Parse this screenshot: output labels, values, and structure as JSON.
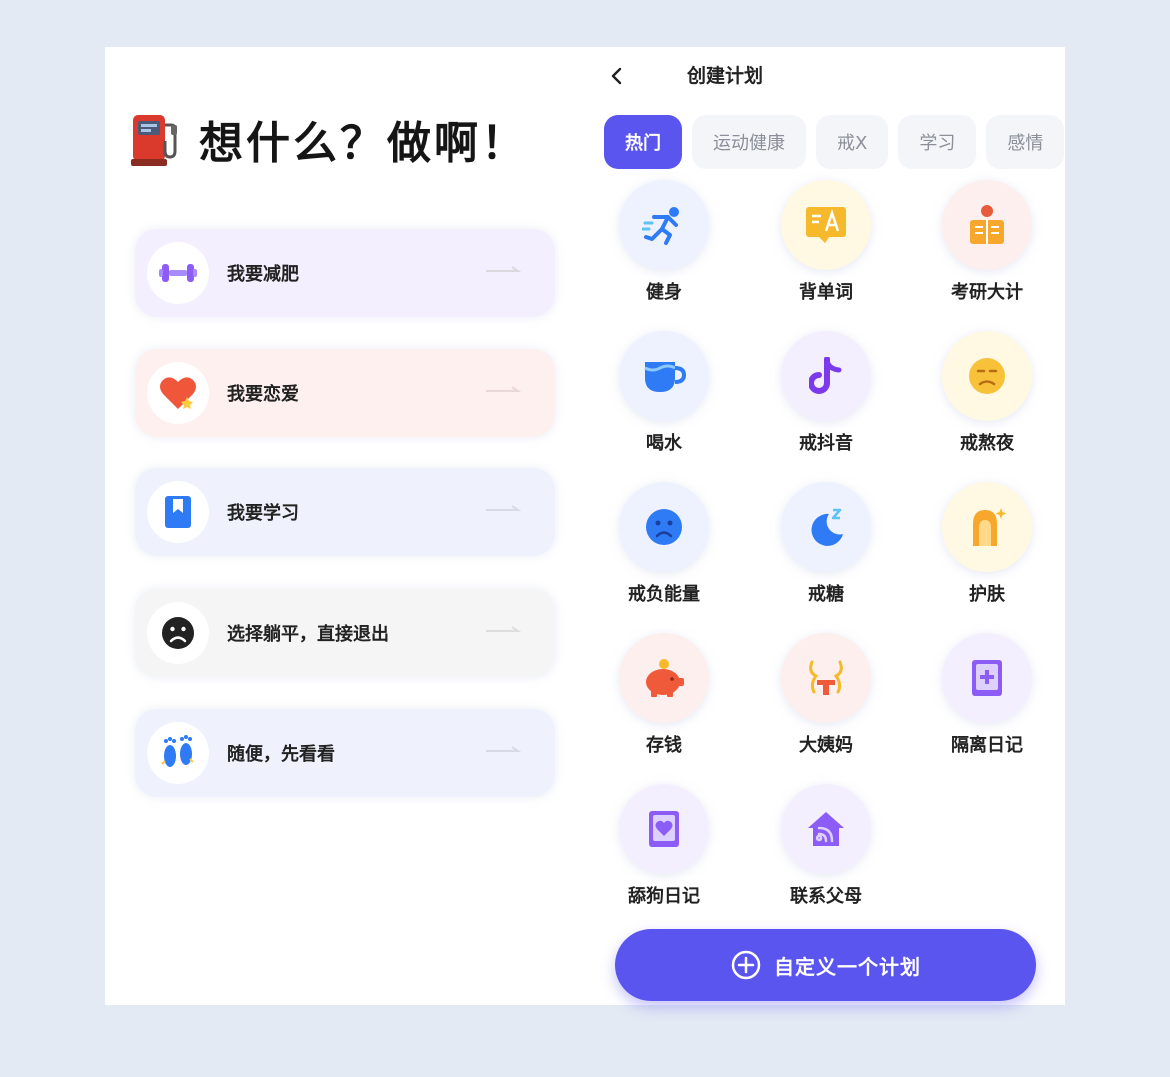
{
  "left": {
    "hero_title": "想什么？做啊！",
    "options": [
      {
        "label": "我要减肥",
        "icon": "dumbbell-icon",
        "bg": "#f4effe"
      },
      {
        "label": "我要恋爱",
        "icon": "heart-icon",
        "bg": "#fdf0ef"
      },
      {
        "label": "我要学习",
        "icon": "bookmark-book-icon",
        "bg": "#eff2fd"
      },
      {
        "label": "选择躺平，直接退出",
        "icon": "sad-face-icon",
        "bg": "#f5f5f6"
      },
      {
        "label": "随便，先看看",
        "icon": "footprints-icon",
        "bg": "#eff2fd"
      }
    ]
  },
  "right": {
    "nav_title": "创建计划",
    "tabs": [
      "热门",
      "运动健康",
      "戒X",
      "学习",
      "感情"
    ],
    "items": [
      {
        "label": "健身",
        "icon": "running-icon"
      },
      {
        "label": "背单词",
        "icon": "translate-icon"
      },
      {
        "label": "考研大计",
        "icon": "exam-desk-icon"
      },
      {
        "label": "喝水",
        "icon": "cup-icon"
      },
      {
        "label": "戒抖音",
        "icon": "tiktok-icon"
      },
      {
        "label": "戒熬夜",
        "icon": "tired-face-icon"
      },
      {
        "label": "戒负能量",
        "icon": "sad-face-icon"
      },
      {
        "label": "戒糖",
        "icon": "moon-sleep-icon"
      },
      {
        "label": "护肤",
        "icon": "skincare-icon"
      },
      {
        "label": "存钱",
        "icon": "piggy-bank-icon"
      },
      {
        "label": "大姨妈",
        "icon": "uterus-icon"
      },
      {
        "label": "隔离日记",
        "icon": "medical-book-icon"
      },
      {
        "label": "舔狗日记",
        "icon": "heart-book-icon"
      },
      {
        "label": "联系父母",
        "icon": "home-wifi-icon"
      }
    ],
    "custom_button": "自定义一个计划"
  },
  "colors": {
    "accent": "#5b55ef",
    "background": "#e3eaf4"
  }
}
